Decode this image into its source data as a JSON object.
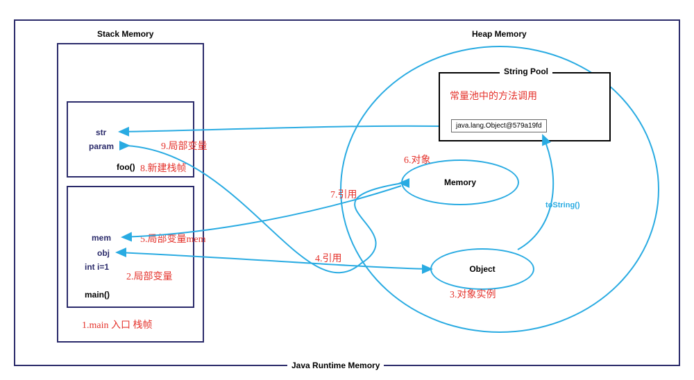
{
  "diagram": {
    "caption": "Java Runtime Memory",
    "stack": {
      "title": "Stack Memory",
      "frame_foo": {
        "vars": {
          "str": "str",
          "param": "param"
        },
        "func": "foo()"
      },
      "frame_main": {
        "vars": {
          "mem": "mem",
          "obj": "obj",
          "inti": "int i=1"
        },
        "func": "main()"
      }
    },
    "heap": {
      "title": "Heap Memory",
      "string_pool": {
        "title": "String Pool",
        "literal": "java.lang.Object@579a19fd"
      },
      "memory_obj": "Memory",
      "object_obj": "Object",
      "tostring": "toString()"
    },
    "annotations": {
      "a1": "1.main 入口 栈帧",
      "a2": "2.局部变量",
      "a3": "3.对象实例",
      "a4": "4.引用",
      "a5": "5.局部变量mem",
      "a6": "6.对象",
      "a7": "7.引用",
      "a8": "8.新建栈帧",
      "a9": "9.局部变量",
      "pool_note": "常量池中的方法调用"
    }
  }
}
